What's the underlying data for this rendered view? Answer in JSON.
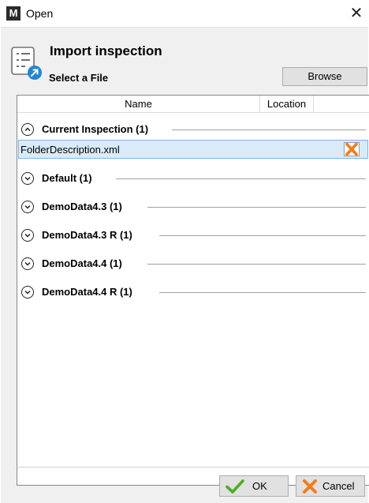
{
  "window": {
    "title": "Open",
    "app_icon_letter": "M",
    "close_glyph": "✕"
  },
  "header": {
    "title": "Import inspection",
    "subtitle": "Select a File",
    "browse_label": "Browse"
  },
  "table": {
    "columns": [
      "Name",
      "Location"
    ],
    "groups": [
      {
        "label": "Current Inspection (1)",
        "expanded": true,
        "files": [
          "FolderDescription.xml"
        ]
      },
      {
        "label": "Default (1)",
        "expanded": false
      },
      {
        "label": "DemoData4.3 (1)",
        "expanded": false
      },
      {
        "label": "DemoData4.3 R (1)",
        "expanded": false
      },
      {
        "label": "DemoData4.4 (1)",
        "expanded": false
      },
      {
        "label": "DemoData4.4 R (1)",
        "expanded": false
      }
    ]
  },
  "footer": {
    "ok_label": "OK",
    "cancel_label": "Cancel"
  },
  "colors": {
    "selection": "#d9ebf9",
    "accent": "#1e88d6",
    "ok_green": "#4caf1e",
    "remove_orange": "#f07e1b"
  },
  "icons": [
    "app-m-icon",
    "close-icon",
    "import-list-icon",
    "chevron-up-icon",
    "chevron-down-icon",
    "remove-x-icon",
    "check-icon",
    "cancel-x-icon"
  ]
}
